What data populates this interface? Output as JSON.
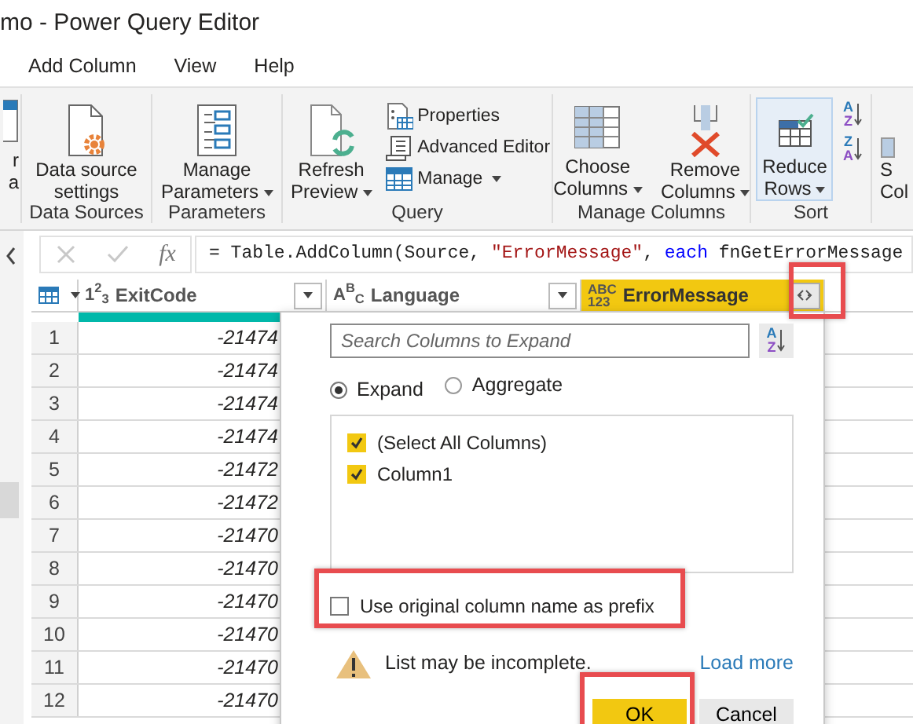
{
  "window": {
    "title": "mo - Power Query Editor"
  },
  "menu": [
    {
      "label": "Add Column"
    },
    {
      "label": "View"
    },
    {
      "label": "Help"
    }
  ],
  "ribbon": {
    "left_cut": [
      "r",
      "a"
    ],
    "groups": [
      {
        "label": "Data Sources",
        "items": [
          {
            "kind": "large",
            "lines": [
              "Data source",
              "settings"
            ],
            "dropdown": false,
            "hovered": false
          }
        ]
      },
      {
        "label": "Parameters",
        "items": [
          {
            "kind": "large",
            "lines": [
              "Manage",
              "Parameters"
            ],
            "dropdown": true,
            "hovered": false
          }
        ]
      },
      {
        "label": "Query",
        "items": [
          {
            "kind": "large",
            "lines": [
              "Refresh",
              "Preview"
            ],
            "dropdown": true,
            "hovered": false
          },
          {
            "kind": "small",
            "label": "Properties",
            "dropdown": false,
            "hovered": false
          },
          {
            "kind": "small",
            "label": "Advanced Editor",
            "dropdown": false,
            "hovered": false
          },
          {
            "kind": "small",
            "label": "Manage",
            "dropdown": true,
            "hovered": false
          }
        ]
      },
      {
        "label": "Manage Columns",
        "items": [
          {
            "kind": "large",
            "lines": [
              "Choose",
              "Columns"
            ],
            "dropdown": true,
            "hovered": false
          },
          {
            "kind": "large",
            "lines": [
              "Remove",
              "Columns"
            ],
            "dropdown": true,
            "hovered": false
          }
        ]
      },
      {
        "label": "Sort",
        "items": [
          {
            "kind": "large",
            "lines": [
              "Reduce",
              "Rows"
            ],
            "dropdown": true,
            "hovered": true
          },
          {
            "kind": "sort",
            "top": "A",
            "bottom": "Z",
            "hovered": false
          },
          {
            "kind": "sort",
            "top": "Z",
            "bottom": "A",
            "hovered": false
          }
        ]
      }
    ],
    "right_cut": [
      "S",
      "Col"
    ]
  },
  "formula_bar": {
    "fx": "fx",
    "parts": [
      {
        "kind": "plain",
        "text": "= Table.AddColumn(Source, "
      },
      {
        "kind": "string",
        "text": "\"ErrorMessage\""
      },
      {
        "kind": "plain",
        "text": ", "
      },
      {
        "kind": "keyword",
        "text": "each"
      },
      {
        "kind": "plain",
        "text": " fnGetErrorMessage"
      }
    ]
  },
  "table": {
    "columns": [
      {
        "type": "1$^{2}$$_{3}$",
        "name": "ExitCode",
        "selected": false,
        "expandable": false
      },
      {
        "type": "A$^{B}$$_{C}$",
        "name": "Language",
        "selected": false,
        "expandable": false
      },
      {
        "type": "ABC\n123",
        "name": "ErrorMessage",
        "selected": true,
        "expandable": true
      }
    ],
    "rows": [
      {
        "number": "1",
        "exit_code": "-21474"
      },
      {
        "number": "2",
        "exit_code": "-21474"
      },
      {
        "number": "3",
        "exit_code": "-21474"
      },
      {
        "number": "4",
        "exit_code": "-21474"
      },
      {
        "number": "5",
        "exit_code": "-21472"
      },
      {
        "number": "6",
        "exit_code": "-21472"
      },
      {
        "number": "7",
        "exit_code": "-21470"
      },
      {
        "number": "8",
        "exit_code": "-21470"
      },
      {
        "number": "9",
        "exit_code": "-21470"
      },
      {
        "number": "10",
        "exit_code": "-21470"
      },
      {
        "number": "11",
        "exit_code": "-21470"
      },
      {
        "number": "12",
        "exit_code": "-21470"
      }
    ]
  },
  "expand_popup": {
    "search": {
      "placeholder": "Search Columns to Expand"
    },
    "sort_button": {
      "top": "A",
      "bottom": "Z"
    },
    "modes": [
      {
        "label": "Expand",
        "selected": true
      },
      {
        "label": "Aggregate",
        "selected": false
      }
    ],
    "columns": [
      {
        "label": "(Select All Columns)",
        "checked": true
      },
      {
        "label": "Column1",
        "checked": true
      }
    ],
    "prefix": {
      "label": "Use original column name as prefix",
      "checked": false
    },
    "warning": "List may be incomplete.",
    "link": "Load more",
    "buttons": [
      {
        "label": "OK",
        "primary": true
      },
      {
        "label": "Cancel",
        "primary": false
      }
    ]
  }
}
